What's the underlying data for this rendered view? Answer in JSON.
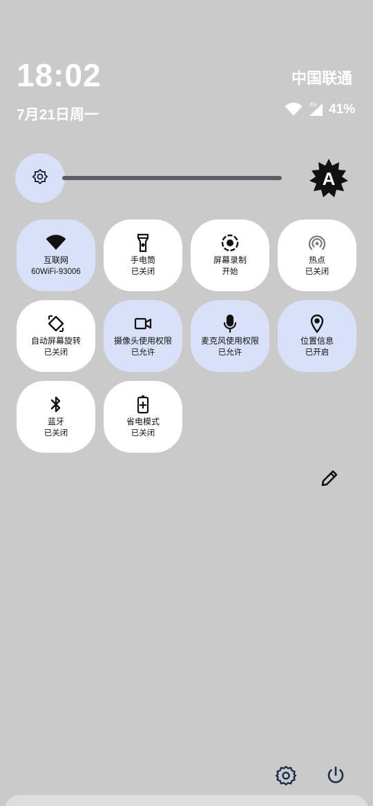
{
  "header": {
    "time": "18:02",
    "carrier": "中国联通",
    "date": "7月21日周一",
    "network_type": "4G",
    "battery": "41%"
  },
  "brightness": {
    "level": 0.0,
    "auto_label": "A"
  },
  "tiles": [
    {
      "title": "互联网",
      "status": "60WiFi-93006",
      "active": true,
      "icon": "wifi-icon"
    },
    {
      "title": "手电筒",
      "status": "已关闭",
      "active": false,
      "icon": "flashlight-icon"
    },
    {
      "title": "屏幕录制",
      "status": "开始",
      "active": false,
      "icon": "screen-record-icon"
    },
    {
      "title": "热点",
      "status": "已关闭",
      "active": false,
      "icon": "hotspot-icon"
    },
    {
      "title": "自动屏幕旋转",
      "status": "已关闭",
      "active": false,
      "icon": "rotate-icon"
    },
    {
      "title": "摄像头使用权限",
      "status": "已允许",
      "active": true,
      "icon": "camera-icon"
    },
    {
      "title": "麦克风使用权限",
      "status": "已允许",
      "active": true,
      "icon": "microphone-icon"
    },
    {
      "title": "位置信息",
      "status": "已开启",
      "active": true,
      "icon": "location-icon"
    },
    {
      "title": "蓝牙",
      "status": "已关闭",
      "active": false,
      "icon": "bluetooth-icon"
    },
    {
      "title": "省电模式",
      "status": "已关闭",
      "active": false,
      "icon": "battery-saver-icon"
    }
  ],
  "colors": {
    "background": "#cacaca",
    "tile_on": "#d9e1f8",
    "tile_off": "#ffffff",
    "icon_dark": "#1c2b4a"
  }
}
